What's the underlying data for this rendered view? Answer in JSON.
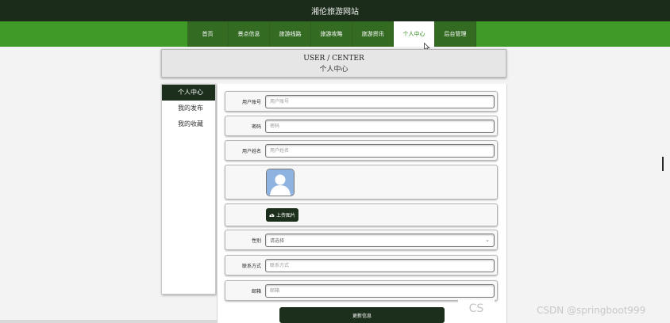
{
  "site": {
    "title": "湘伦旅游网站"
  },
  "nav": {
    "items": [
      {
        "label": "首页",
        "active": false
      },
      {
        "label": "景点信息",
        "active": false
      },
      {
        "label": "旅游线路",
        "active": false
      },
      {
        "label": "旅游攻略",
        "active": false
      },
      {
        "label": "旅游资讯",
        "active": false
      },
      {
        "label": "个人中心",
        "active": true
      },
      {
        "label": "后台管理",
        "active": false
      }
    ]
  },
  "header": {
    "title_en": "USER / CENTER",
    "title_cn": "个人中心"
  },
  "sidebar": {
    "items": [
      {
        "label": "个人中心",
        "active": true
      },
      {
        "label": "我的发布",
        "active": false
      },
      {
        "label": "我的收藏",
        "active": false
      }
    ]
  },
  "form": {
    "account": {
      "label": "用户账号",
      "placeholder": "用户账号"
    },
    "password": {
      "label": "密码",
      "placeholder": "密码"
    },
    "name": {
      "label": "用户姓名",
      "placeholder": "用户姓名"
    },
    "upload_label": "上传图片",
    "gender": {
      "label": "性别",
      "value": "请选择"
    },
    "contact": {
      "label": "联系方式",
      "placeholder": "联系方式"
    },
    "email": {
      "label": "邮箱",
      "placeholder": "邮箱"
    },
    "submit_label": "更新信息"
  },
  "watermark": "CSDN @springboot999",
  "watermark_small": "CS",
  "colors": {
    "topbar": "#1b2d1a",
    "navbar": "#3f9a28",
    "dark_button": "#1c2f1c",
    "active_nav_text": "#2f8a1c"
  }
}
